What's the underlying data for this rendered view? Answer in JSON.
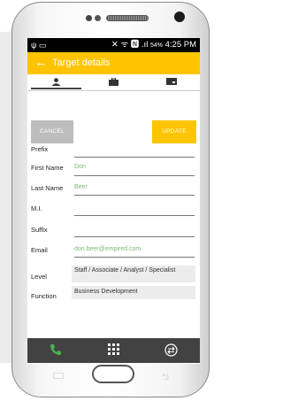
{
  "status_bar": {
    "left_icons": "ψ ▭",
    "right_icons": "✕ ᯤ 🅽 .ıl",
    "battery": "54%",
    "time": "4:25 PM"
  },
  "app_bar": {
    "back_glyph": "←",
    "title": "Target details"
  },
  "tabs": [
    "person",
    "briefcase",
    "card"
  ],
  "buttons": {
    "cancel": "CANCEL",
    "update": "UPDATE"
  },
  "form": {
    "prefix": {
      "label": "Prefix",
      "value": ""
    },
    "first_name": {
      "label": "First Name",
      "value": "Don"
    },
    "last_name": {
      "label": "Last Name",
      "value": "Beer"
    },
    "mi": {
      "label": "M.I.",
      "value": ""
    },
    "suffix": {
      "label": "Suffix",
      "value": ""
    },
    "email": {
      "label": "Email",
      "value": "don.beer@empired.com"
    },
    "level": {
      "label": "Level",
      "value": "Staff / Associate / Analyst / Specialist"
    },
    "function": {
      "label": "Function",
      "value": "Business Development"
    }
  },
  "nav": [
    "phone",
    "dialpad",
    "swap"
  ],
  "colors": {
    "accent": "#ffc400",
    "nav_bg": "#424242",
    "phone_green": "#4caf50",
    "field_text": "#7ab87a"
  }
}
